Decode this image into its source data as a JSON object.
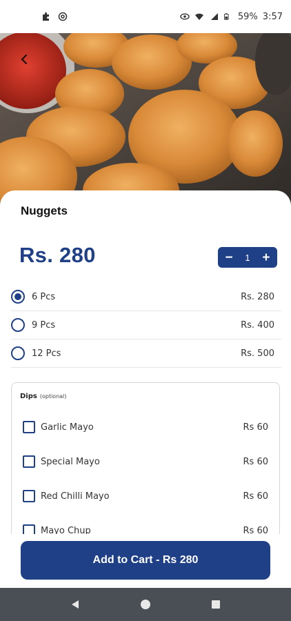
{
  "status_bar": {
    "battery": "59%",
    "time": "3:57",
    "icons_left": [
      "puzzle-icon",
      "at-sign-icon"
    ],
    "icons_right": [
      "eye-icon",
      "wifi-icon",
      "signal-icon",
      "battery-icon"
    ]
  },
  "header": {
    "back_icon": "back-arrow-icon"
  },
  "product": {
    "name": "Nuggets",
    "price": "Rs. 280",
    "quantity": "1"
  },
  "stepper": {
    "minus": "−",
    "plus": "+"
  },
  "options": [
    {
      "label": "6 Pcs",
      "price": "Rs. 280",
      "selected": true
    },
    {
      "label": "9 Pcs",
      "price": "Rs. 400",
      "selected": false
    },
    {
      "label": "12 Pcs",
      "price": "Rs. 500",
      "selected": false
    }
  ],
  "dips": {
    "title": "Dips",
    "optional": "(optional)",
    "items": [
      {
        "label": "Garlic Mayo",
        "price": "Rs 60"
      },
      {
        "label": "Special Mayo",
        "price": "Rs 60"
      },
      {
        "label": "Red Chilli Mayo",
        "price": "Rs 60"
      },
      {
        "label": "Mayo Chup",
        "price": "Rs 60"
      }
    ]
  },
  "cart": {
    "label": "Add to Cart - Rs 280"
  },
  "colors": {
    "accent": "#1f3f86",
    "nav_bar": "#4a4f55"
  }
}
